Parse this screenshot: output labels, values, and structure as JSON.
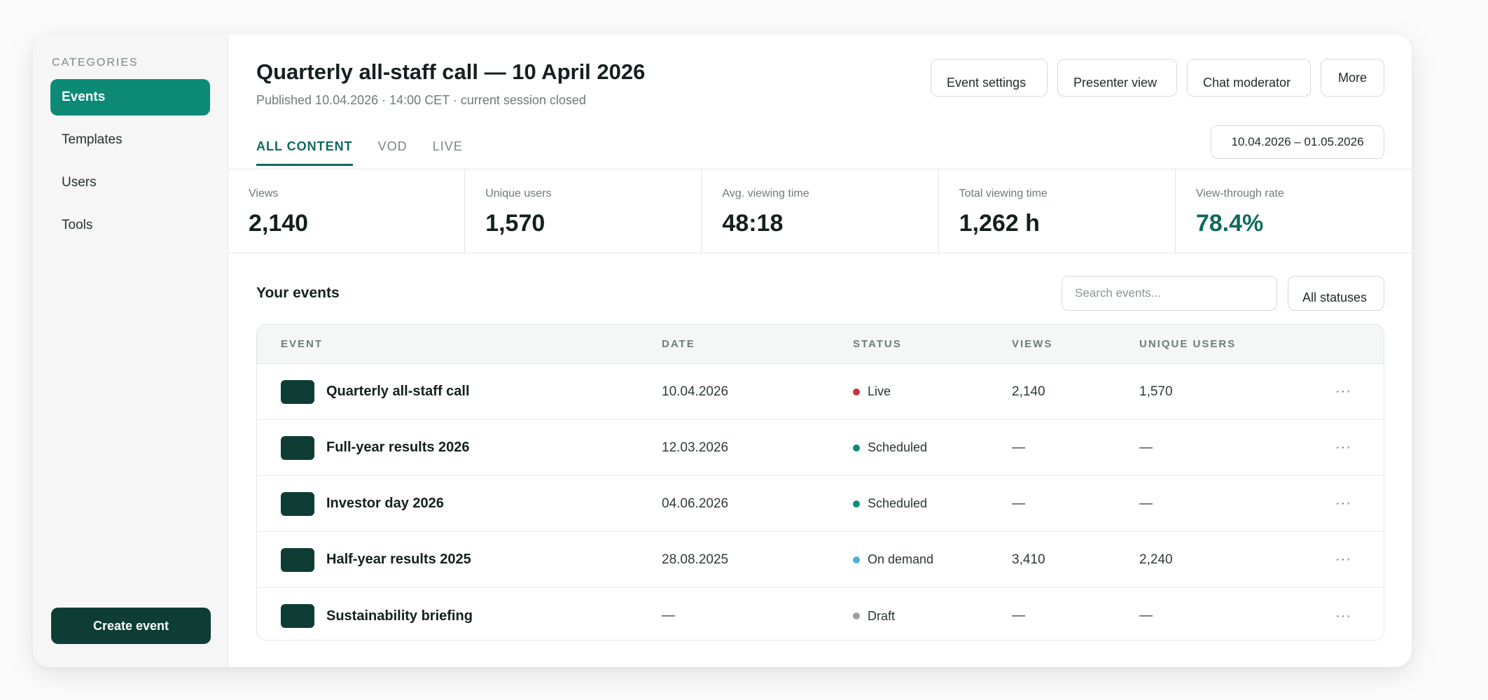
{
  "sidebar": {
    "heading": "CATEGORIES",
    "items": [
      {
        "label": "Events",
        "active": true
      },
      {
        "label": "Templates",
        "active": false
      },
      {
        "label": "Users",
        "active": false
      },
      {
        "label": "Tools",
        "active": false
      }
    ],
    "create_label": "Create event"
  },
  "header": {
    "title": "Quarterly all-staff call — 10 April 2026",
    "subtitle": "Published 10.04.2026 · 14:00 CET · current session closed",
    "actions": [
      "Event settings",
      "Presenter view",
      "Chat moderator",
      "More"
    ]
  },
  "tabs": [
    {
      "label": "ALL CONTENT",
      "active": true
    },
    {
      "label": "VOD",
      "active": false
    },
    {
      "label": "LIVE",
      "active": false
    }
  ],
  "date_range": "10.04.2026 – 01.05.2026",
  "stats": [
    {
      "label": "Views",
      "value": "2,140"
    },
    {
      "label": "Unique users",
      "value": "1,570"
    },
    {
      "label": "Avg. viewing time",
      "value": "48:18"
    },
    {
      "label": "Total viewing time",
      "value": "1,262 h"
    },
    {
      "label": "View-through rate",
      "value": "78.4%"
    }
  ],
  "events_section": {
    "title": "Your events",
    "search_placeholder": "Search events...",
    "status_filter": "All statuses"
  },
  "table": {
    "columns": [
      "EVENT",
      "DATE",
      "STATUS",
      "VIEWS",
      "UNIQUE USERS"
    ],
    "rows": [
      {
        "name": "Quarterly all-staff call",
        "date": "10.04.2026",
        "status": "Live",
        "status_color": "#c8323c",
        "views": "2,140",
        "users": "1,570"
      },
      {
        "name": "Full-year results 2026",
        "date": "12.03.2026",
        "status": "Scheduled",
        "status_color": "#0c8a76",
        "views": "—",
        "users": "—"
      },
      {
        "name": "Investor day 2026",
        "date": "04.06.2026",
        "status": "Scheduled",
        "status_color": "#0c8a76",
        "views": "—",
        "users": "—"
      },
      {
        "name": "Half-year results 2025",
        "date": "28.08.2025",
        "status": "On demand",
        "status_color": "#4aaee0",
        "views": "3,410",
        "users": "2,240"
      },
      {
        "name": "Sustainability briefing",
        "date": "—",
        "status": "Draft",
        "status_color": "#9aa19f",
        "views": "—",
        "users": "—"
      }
    ],
    "row_menu_glyph": "···"
  },
  "colors": {
    "accent": "#0c8a76",
    "accent_dark": "#0e3d36",
    "accent_text": "#0f6a5c"
  }
}
